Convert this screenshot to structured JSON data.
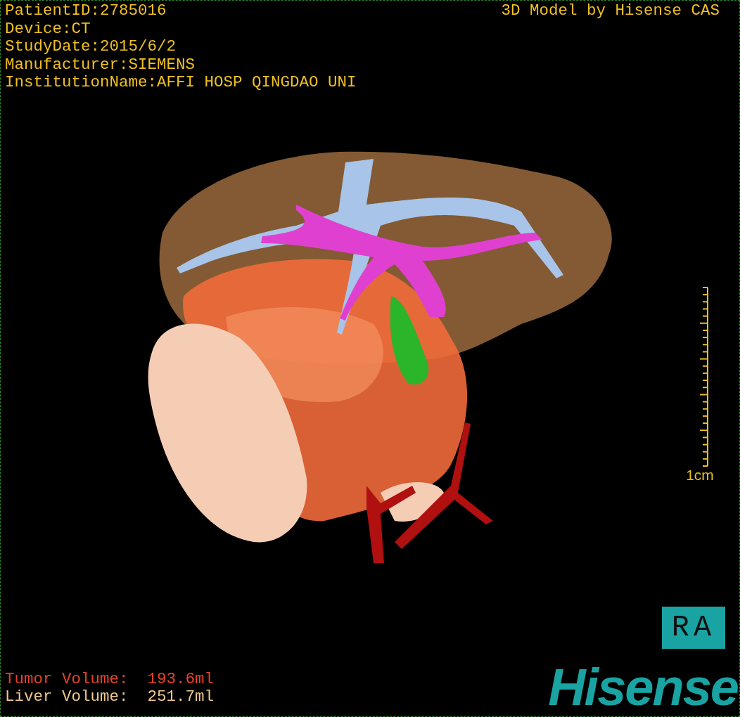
{
  "study_info": [
    "PatientID:2785016",
    "Device:CT",
    "StudyDate:2015/6/2",
    "Manufacturer:SIEMENS",
    "InstitutionName:AFFI HOSP QINGDAO UNI"
  ],
  "model_credit": "3D Model by Hisense CAS",
  "scale_bar": {
    "label": "1cm"
  },
  "orientation": "RA",
  "volumes": [
    {
      "label": "Tumor Volume:",
      "value": "193.6ml",
      "color": "#e8432a"
    },
    {
      "label": "Liver Volume:",
      "value": "251.7ml",
      "color": "#f0c890"
    }
  ],
  "logo": "Hisense"
}
